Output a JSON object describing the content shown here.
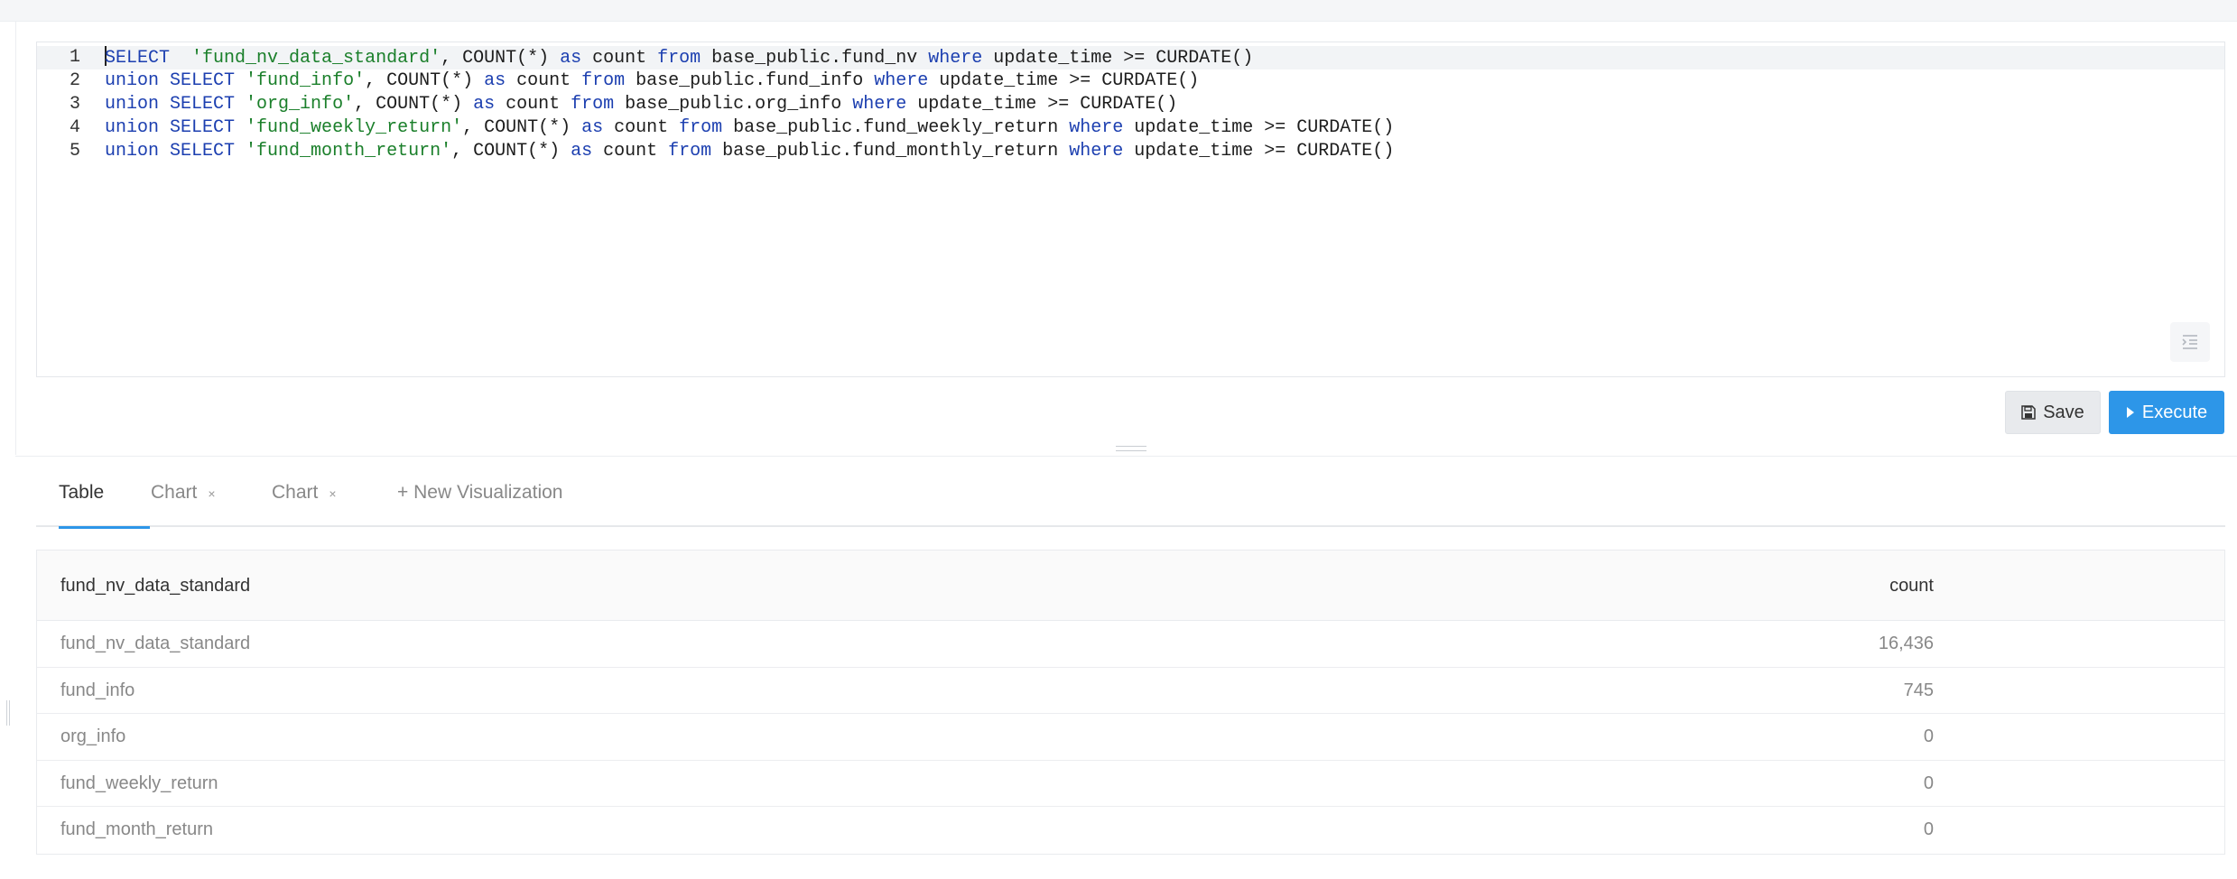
{
  "editor": {
    "lines": [
      {
        "num": "1",
        "tokens": [
          {
            "t": "SELECT",
            "c": "kw"
          },
          {
            "t": "  ",
            "c": "plain"
          },
          {
            "t": "'fund_nv_data_standard'",
            "c": "str"
          },
          {
            "t": ", COUNT(*) ",
            "c": "plain"
          },
          {
            "t": "as",
            "c": "kw"
          },
          {
            "t": " count ",
            "c": "plain"
          },
          {
            "t": "from",
            "c": "kw"
          },
          {
            "t": " base_public.fund_nv ",
            "c": "plain"
          },
          {
            "t": "where",
            "c": "kw"
          },
          {
            "t": " update_time >= CURDATE()",
            "c": "plain"
          }
        ]
      },
      {
        "num": "2",
        "tokens": [
          {
            "t": "union SELECT",
            "c": "kw"
          },
          {
            "t": " ",
            "c": "plain"
          },
          {
            "t": "'fund_info'",
            "c": "str"
          },
          {
            "t": ", COUNT(*) ",
            "c": "plain"
          },
          {
            "t": "as",
            "c": "kw"
          },
          {
            "t": " count ",
            "c": "plain"
          },
          {
            "t": "from",
            "c": "kw"
          },
          {
            "t": " base_public.fund_info ",
            "c": "plain"
          },
          {
            "t": "where",
            "c": "kw"
          },
          {
            "t": " update_time >= CURDATE()",
            "c": "plain"
          }
        ]
      },
      {
        "num": "3",
        "tokens": [
          {
            "t": "union SELECT",
            "c": "kw"
          },
          {
            "t": " ",
            "c": "plain"
          },
          {
            "t": "'org_info'",
            "c": "str"
          },
          {
            "t": ", COUNT(*) ",
            "c": "plain"
          },
          {
            "t": "as",
            "c": "kw"
          },
          {
            "t": " count ",
            "c": "plain"
          },
          {
            "t": "from",
            "c": "kw"
          },
          {
            "t": " base_public.org_info ",
            "c": "plain"
          },
          {
            "t": "where",
            "c": "kw"
          },
          {
            "t": " update_time >= CURDATE()",
            "c": "plain"
          }
        ]
      },
      {
        "num": "4",
        "tokens": [
          {
            "t": "union SELECT",
            "c": "kw"
          },
          {
            "t": " ",
            "c": "plain"
          },
          {
            "t": "'fund_weekly_return'",
            "c": "str"
          },
          {
            "t": ", COUNT(*) ",
            "c": "plain"
          },
          {
            "t": "as",
            "c": "kw"
          },
          {
            "t": " count ",
            "c": "plain"
          },
          {
            "t": "from",
            "c": "kw"
          },
          {
            "t": " base_public.fund_weekly_return ",
            "c": "plain"
          },
          {
            "t": "where",
            "c": "kw"
          },
          {
            "t": " update_time >= CURDATE()",
            "c": "plain"
          }
        ]
      },
      {
        "num": "5",
        "tokens": [
          {
            "t": "union SELECT",
            "c": "kw"
          },
          {
            "t": " ",
            "c": "plain"
          },
          {
            "t": "'fund_month_return'",
            "c": "str"
          },
          {
            "t": ", COUNT(*) ",
            "c": "plain"
          },
          {
            "t": "as",
            "c": "kw"
          },
          {
            "t": " count ",
            "c": "plain"
          },
          {
            "t": "from",
            "c": "kw"
          },
          {
            "t": " base_public.fund_monthly_return ",
            "c": "plain"
          },
          {
            "t": "where",
            "c": "kw"
          },
          {
            "t": " update_time >= CURDATE()",
            "c": "plain"
          }
        ]
      }
    ],
    "format_icon": "indent-icon"
  },
  "actions": {
    "save_label": "Save",
    "save_icon": "floppy-disk-icon",
    "execute_label": "Execute",
    "execute_icon": "play-icon"
  },
  "tabs": [
    {
      "label": "Table",
      "active": true,
      "closable": false
    },
    {
      "label": "Chart",
      "active": false,
      "closable": true
    },
    {
      "label": "Chart",
      "active": false,
      "closable": true
    },
    {
      "label": "+ New Visualization",
      "active": false,
      "closable": false
    }
  ],
  "tab_close_glyph": "×",
  "table": {
    "columns": [
      "fund_nv_data_standard",
      "count"
    ],
    "rows": [
      [
        "fund_nv_data_standard",
        "16,436"
      ],
      [
        "fund_info",
        "745"
      ],
      [
        "org_info",
        "0"
      ],
      [
        "fund_weekly_return",
        "0"
      ],
      [
        "fund_month_return",
        "0"
      ]
    ]
  },
  "colors": {
    "accent": "#2d96e8",
    "keyword": "#1c3fb0",
    "string": "#1a7f2a"
  }
}
